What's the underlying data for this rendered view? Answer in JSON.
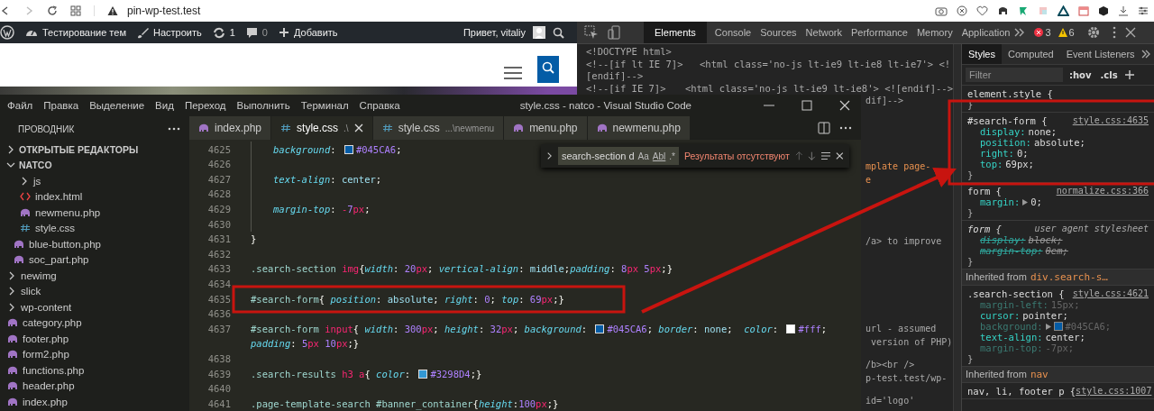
{
  "browser": {
    "url": "pin-wp-test.test"
  },
  "admin_bar": {
    "items": [
      {
        "kind": "logo"
      },
      {
        "kind": "site",
        "label": "Тестирование тем"
      },
      {
        "kind": "customize",
        "label": "Настроить"
      },
      {
        "kind": "updates",
        "label": "1"
      },
      {
        "kind": "comments",
        "label": "0"
      },
      {
        "kind": "new",
        "label": "Добавить"
      }
    ],
    "greeting": "Привет, vitaliy"
  },
  "vscode": {
    "menu": [
      "Файл",
      "Правка",
      "Выделение",
      "Вид",
      "Переход",
      "Выполнить",
      "Терминал",
      "Справка"
    ],
    "title": "style.css - natco - Visual Studio Code",
    "explorer": {
      "title": "ПРОВОДНИК",
      "sections": [
        {
          "label": "ОТКРЫТЫЕ РЕДАКТОРЫ",
          "expanded": false
        },
        {
          "label": "NATCO",
          "expanded": true,
          "children": [
            {
              "kind": "group",
              "children": [
                {
                  "kind": "group",
                  "children": [
                    {
                      "kind": "folder",
                      "label": "js",
                      "expanded": false
                    },
                    {
                      "kind": "html",
                      "label": "index.html"
                    },
                    {
                      "kind": "php",
                      "label": "newmenu.php"
                    },
                    {
                      "kind": "css",
                      "label": "style.css"
                    }
                  ]
                },
                {
                  "kind": "php",
                  "label": "blue-button.php"
                },
                {
                  "kind": "php",
                  "label": "soc_part.php"
                }
              ]
            },
            {
              "kind": "folder",
              "label": "newimg",
              "expanded": false
            },
            {
              "kind": "folder",
              "label": "slick",
              "expanded": false
            },
            {
              "kind": "folder",
              "label": "wp-content",
              "expanded": false
            },
            {
              "kind": "php",
              "label": "category.php"
            },
            {
              "kind": "php",
              "label": "footer.php"
            },
            {
              "kind": "php",
              "label": "form2.php"
            },
            {
              "kind": "php",
              "label": "functions.php"
            },
            {
              "kind": "php",
              "label": "header.php"
            },
            {
              "kind": "php",
              "label": "index.php"
            }
          ]
        }
      ]
    },
    "tabs": [
      {
        "kind": "php",
        "label": "index.php",
        "selected": false
      },
      {
        "kind": "css",
        "label": "style.css",
        "detail": ".\\",
        "selected": true
      },
      {
        "kind": "css",
        "label": "style.css",
        "detail": "...\\newmenu",
        "selected": false
      },
      {
        "kind": "php",
        "label": "menu.php",
        "selected": false
      },
      {
        "kind": "php",
        "label": "newmenu.php",
        "selected": false
      }
    ],
    "find": {
      "value": "search-section d",
      "options": [
        "Aa",
        "Abl",
        ".*"
      ],
      "status": "Результаты отсутствуют"
    },
    "code": [
      {
        "number": "4625",
        "indent": true,
        "tokens": [
          {
            "kind": "prop",
            "t": "background"
          },
          {
            "kind": "p",
            "t": ": "
          },
          {
            "kind": "swatch",
            "color": "#045ca6"
          },
          {
            "kind": "num",
            "t": "#045CA6"
          },
          {
            "kind": "p",
            "t": ";"
          }
        ]
      },
      {
        "number": "4626",
        "indent": true
      },
      {
        "number": "4627",
        "indent": true,
        "tokens": [
          {
            "kind": "prop",
            "t": "text-align"
          },
          {
            "kind": "p",
            "t": ": "
          },
          {
            "kind": "val",
            "t": "center"
          },
          {
            "kind": "p",
            "t": ";"
          }
        ]
      },
      {
        "number": "4628",
        "indent": true
      },
      {
        "number": "4629",
        "indent": true,
        "tokens": [
          {
            "kind": "prop",
            "t": "margin-top"
          },
          {
            "kind": "p",
            "t": ": "
          },
          {
            "kind": "unit",
            "t": "-"
          },
          {
            "kind": "num",
            "t": "7"
          },
          {
            "kind": "unit",
            "t": "px"
          },
          {
            "kind": "p",
            "t": ";"
          }
        ]
      },
      {
        "number": "4630",
        "indent": true
      },
      {
        "number": "4631",
        "tokens": [
          {
            "kind": "p",
            "t": "}"
          }
        ]
      },
      {
        "number": "4632"
      },
      {
        "number": "4633",
        "tokens": [
          {
            "kind": "sel",
            "t": ".search-section "
          },
          {
            "kind": "tag",
            "t": "img"
          },
          {
            "kind": "p",
            "t": "{"
          },
          {
            "kind": "prop",
            "t": "width"
          },
          {
            "kind": "p",
            "t": ": "
          },
          {
            "kind": "num",
            "t": "20"
          },
          {
            "kind": "unit",
            "t": "px"
          },
          {
            "kind": "p",
            "t": "; "
          },
          {
            "kind": "prop",
            "t": "vertical-align"
          },
          {
            "kind": "p",
            "t": ": "
          },
          {
            "kind": "val",
            "t": "middle"
          },
          {
            "kind": "p",
            "t": ";"
          },
          {
            "kind": "prop",
            "t": "padding"
          },
          {
            "kind": "p",
            "t": ": "
          },
          {
            "kind": "num",
            "t": "8"
          },
          {
            "kind": "unit",
            "t": "px"
          },
          {
            "kind": "num",
            "t": " 5"
          },
          {
            "kind": "unit",
            "t": "px"
          },
          {
            "kind": "p",
            "t": ";}"
          }
        ]
      },
      {
        "number": "4634"
      },
      {
        "number": "4635",
        "tokens": [
          {
            "kind": "sel",
            "t": "#search-form"
          },
          {
            "kind": "p",
            "t": "{ "
          },
          {
            "kind": "prop",
            "t": "position"
          },
          {
            "kind": "p",
            "t": ": "
          },
          {
            "kind": "val",
            "t": "absolute"
          },
          {
            "kind": "p",
            "t": "; "
          },
          {
            "kind": "prop",
            "t": "right"
          },
          {
            "kind": "p",
            "t": ": "
          },
          {
            "kind": "num",
            "t": "0"
          },
          {
            "kind": "p",
            "t": "; "
          },
          {
            "kind": "prop",
            "t": "top"
          },
          {
            "kind": "p",
            "t": ": "
          },
          {
            "kind": "num",
            "t": "69"
          },
          {
            "kind": "unit",
            "t": "px"
          },
          {
            "kind": "p",
            "t": ";}"
          }
        ]
      },
      {
        "number": "4636"
      },
      {
        "number": "4637",
        "tokens": [
          {
            "kind": "sel",
            "t": "#search-form "
          },
          {
            "kind": "tag",
            "t": "input"
          },
          {
            "kind": "p",
            "t": "{ "
          },
          {
            "kind": "prop",
            "t": "width"
          },
          {
            "kind": "p",
            "t": ": "
          },
          {
            "kind": "num",
            "t": "300"
          },
          {
            "kind": "unit",
            "t": "px"
          },
          {
            "kind": "p",
            "t": "; "
          },
          {
            "kind": "prop",
            "t": "height"
          },
          {
            "kind": "p",
            "t": ": "
          },
          {
            "kind": "num",
            "t": "32"
          },
          {
            "kind": "unit",
            "t": "px"
          },
          {
            "kind": "p",
            "t": "; "
          },
          {
            "kind": "prop",
            "t": "background"
          },
          {
            "kind": "p",
            "t": ": "
          },
          {
            "kind": "swatch",
            "color": "#045ca6"
          },
          {
            "kind": "num",
            "t": "#045CA6"
          },
          {
            "kind": "p",
            "t": "; "
          },
          {
            "kind": "prop",
            "t": "border"
          },
          {
            "kind": "p",
            "t": ": "
          },
          {
            "kind": "val",
            "t": "none"
          },
          {
            "kind": "p",
            "t": ";  "
          },
          {
            "kind": "prop",
            "t": "color"
          },
          {
            "kind": "p",
            "t": ": "
          },
          {
            "kind": "swatch",
            "color": "#ffffff"
          },
          {
            "kind": "num",
            "t": "#fff"
          },
          {
            "kind": "p",
            "t": ";"
          }
        ],
        "continuation": [
          {
            "kind": "prop",
            "t": "padding"
          },
          {
            "kind": "p",
            "t": ": "
          },
          {
            "kind": "num",
            "t": "5"
          },
          {
            "kind": "unit",
            "t": "px"
          },
          {
            "kind": "num",
            "t": " 10"
          },
          {
            "kind": "unit",
            "t": "px"
          },
          {
            "kind": "p",
            "t": ";}"
          }
        ]
      },
      {
        "number": "4638"
      },
      {
        "number": "4639",
        "tokens": [
          {
            "kind": "sel",
            "t": ".search-results "
          },
          {
            "kind": "tag",
            "t": "h3 a"
          },
          {
            "kind": "p",
            "t": "{ "
          },
          {
            "kind": "prop",
            "t": "color"
          },
          {
            "kind": "p",
            "t": ": "
          },
          {
            "kind": "swatch",
            "color": "#3298d4"
          },
          {
            "kind": "num",
            "t": "#3298D4"
          },
          {
            "kind": "p",
            "t": ";}"
          }
        ]
      },
      {
        "number": "4640"
      },
      {
        "number": "4641",
        "tokens": [
          {
            "kind": "sel",
            "t": ".page-template-search #banner_container"
          },
          {
            "kind": "p",
            "t": "{"
          },
          {
            "kind": "prop",
            "t": "height"
          },
          {
            "kind": "p",
            "t": ":"
          },
          {
            "kind": "num",
            "t": "100"
          },
          {
            "kind": "unit",
            "t": "px"
          },
          {
            "kind": "p",
            "t": ";}"
          }
        ]
      }
    ]
  },
  "devtools": {
    "tabs": [
      {
        "label": "Elements",
        "selected": true
      },
      {
        "label": "Console",
        "selected": false
      },
      {
        "label": "Sources",
        "selected": false
      },
      {
        "label": "Network",
        "selected": false
      },
      {
        "label": "Performance",
        "selected": false
      },
      {
        "label": "Memory",
        "selected": false
      },
      {
        "label": "Application",
        "selected": false
      }
    ],
    "errors": "3",
    "warnings": "6",
    "elements": {
      "lines": [
        {
          "parts": [
            "<!DOCTYPE html>"
          ]
        },
        {
          "parts": [
            "<!--[if lt IE 7]>",
            "<html class='no-js lt-ie9 lt-ie8 lt-ie7'> <!"
          ]
        },
        {
          "parts": [
            "[endif]-->"
          ]
        },
        {
          "parts": [
            "<!--[if IE 7]>",
            "<html class='no-js lt-ie9 lt-ie8'> <![endif]-->"
          ]
        }
      ],
      "fragments": [
        [
          {
            "t": "dif]-->",
            "kind": "comment"
          }
        ],
        [
          {
            "t": "mplate page-",
            "kind": "attr"
          },
          {
            "t": "e",
            "kind": "attr"
          }
        ],
        [
          {
            "t": "/a> to improve",
            "kind": "comment"
          }
        ],
        [
          {
            "t": "url - assumed",
            "kind": "comment"
          },
          {
            "t": " version of PHP)",
            "kind": "comment"
          }
        ],
        [
          {
            "t": "/b><br />",
            "kind": "comment"
          },
          {
            "t": "p-test.test/wp-",
            "kind": "comment"
          }
        ],
        [
          {
            "t": "id='logo'",
            "kind": "comment"
          }
        ]
      ]
    },
    "styles": {
      "tabs": [
        {
          "label": "Styles",
          "selected": true
        },
        {
          "label": "Computed",
          "selected": false
        },
        {
          "label": "Event Listeners",
          "selected": false
        }
      ],
      "filter_placeholder": "Filter",
      "hov": ":hov",
      "cls": ".cls",
      "rules": [
        {
          "kind": "rule",
          "selector": "element.style {",
          "close": "}"
        },
        {
          "kind": "rule",
          "selector": "#search-form {",
          "source": "style.css:4635",
          "close": "}",
          "decls": [
            {
              "prop": "display:",
              "value": "none;",
              "overridden": false,
              "inactive": false
            },
            {
              "prop": "position:",
              "value": "absolute;",
              "overridden": false,
              "inactive": false
            },
            {
              "prop": "right:",
              "value": "0;",
              "overridden": false,
              "inactive": false
            },
            {
              "prop": "top:",
              "value": "69px;",
              "overridden": false,
              "inactive": false
            }
          ]
        },
        {
          "kind": "rule",
          "selector": "form {",
          "source": "normalize.css:366",
          "close": "}",
          "decls": [
            {
              "prop": "margin:",
              "value": "0;",
              "expandable": true,
              "overridden": false,
              "inactive": false
            }
          ]
        },
        {
          "kind": "ua-rule",
          "selector": "form {",
          "source": "user agent stylesheet",
          "close": "}",
          "decls": [
            {
              "prop": "display:",
              "value": "block;",
              "overridden": true,
              "inactive": false
            },
            {
              "prop": "margin-top:",
              "value": "0em;",
              "overridden": true,
              "inactive": false
            }
          ]
        },
        {
          "kind": "inherited",
          "label": "Inherited from",
          "element": "div.search-s…"
        },
        {
          "kind": "rule",
          "selector": ".search-section {",
          "source": "style.css:4621",
          "close": "}",
          "decls": [
            {
              "prop": "margin-left:",
              "value": "15px;",
              "overridden": false,
              "inactive": true
            },
            {
              "prop": "cursor:",
              "value": "pointer;",
              "overridden": false,
              "inactive": false
            },
            {
              "prop": "background:",
              "value": "#045CA6;",
              "expandable": true,
              "color": "#045ca6",
              "overridden": false,
              "inactive": true
            },
            {
              "prop": "text-align:",
              "value": "center;",
              "overridden": false,
              "inactive": false
            },
            {
              "prop": "margin-top:",
              "value": "-7px;",
              "overridden": false,
              "inactive": true
            }
          ]
        },
        {
          "kind": "inherited",
          "label": "Inherited from",
          "element": "nav"
        },
        {
          "kind": "rule",
          "selector": "nav, li, footer p {",
          "source": "style.css:1007"
        }
      ]
    }
  }
}
